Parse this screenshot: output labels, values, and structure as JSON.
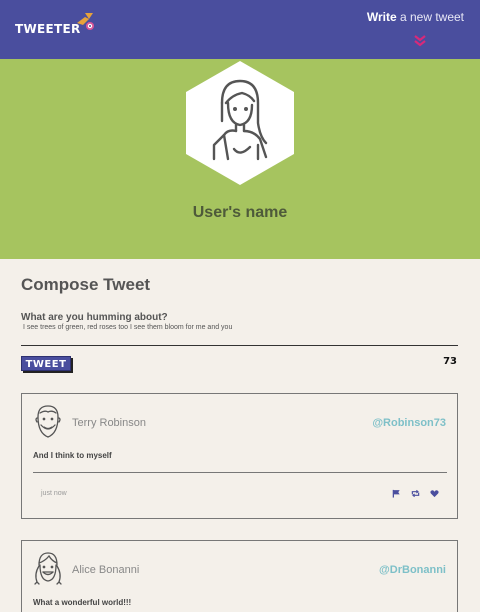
{
  "header": {
    "logo": "TWEETER",
    "write_bold": "Write",
    "write_rest": " a new tweet",
    "logo_icon": "bird-icon",
    "chevron_icon": "double-chevron-down-icon"
  },
  "profile": {
    "user_name": "User's name",
    "avatar_icon": "woman-avatar-icon"
  },
  "compose": {
    "title": "Compose Tweet",
    "prompt_label": "What are you humming about?",
    "prompt_text": "I see trees of green, red roses too I see them bloom for me and you",
    "button_label": "TWEET",
    "char_count": "73"
  },
  "tweets": [
    {
      "author": "Terry Robinson",
      "handle": "@Robinson73",
      "text": "And I think to myself",
      "time": "just now",
      "avatar_icon": "bearded-man-avatar-icon"
    },
    {
      "author": "Alice Bonanni",
      "handle": "@DrBonanni",
      "text": "What a wonderful world!!!",
      "avatar_icon": "woman-pigtails-avatar-icon"
    }
  ],
  "colors": {
    "header_bg": "#4a4e9e",
    "profile_bg": "#a6c45f",
    "page_bg": "#f4f0ea",
    "handle": "#7ec0c8",
    "heart": "#4a4e9e"
  }
}
